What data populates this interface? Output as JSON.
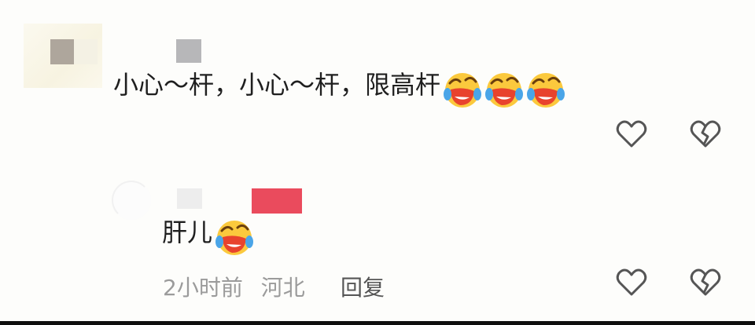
{
  "comment": {
    "text": "小心～杆，小心～杆，限高杆",
    "emoji": "laughing-crying-emoji"
  },
  "reply": {
    "text": "肝儿",
    "emoji": "laughing-crying-emoji",
    "time": "2小时前",
    "location": "河北",
    "reply_label": "回复"
  },
  "colors": {
    "background": "#fdfdfb",
    "text": "#1f1f1f",
    "meta": "#9b9b9b",
    "icon": "#555555"
  }
}
